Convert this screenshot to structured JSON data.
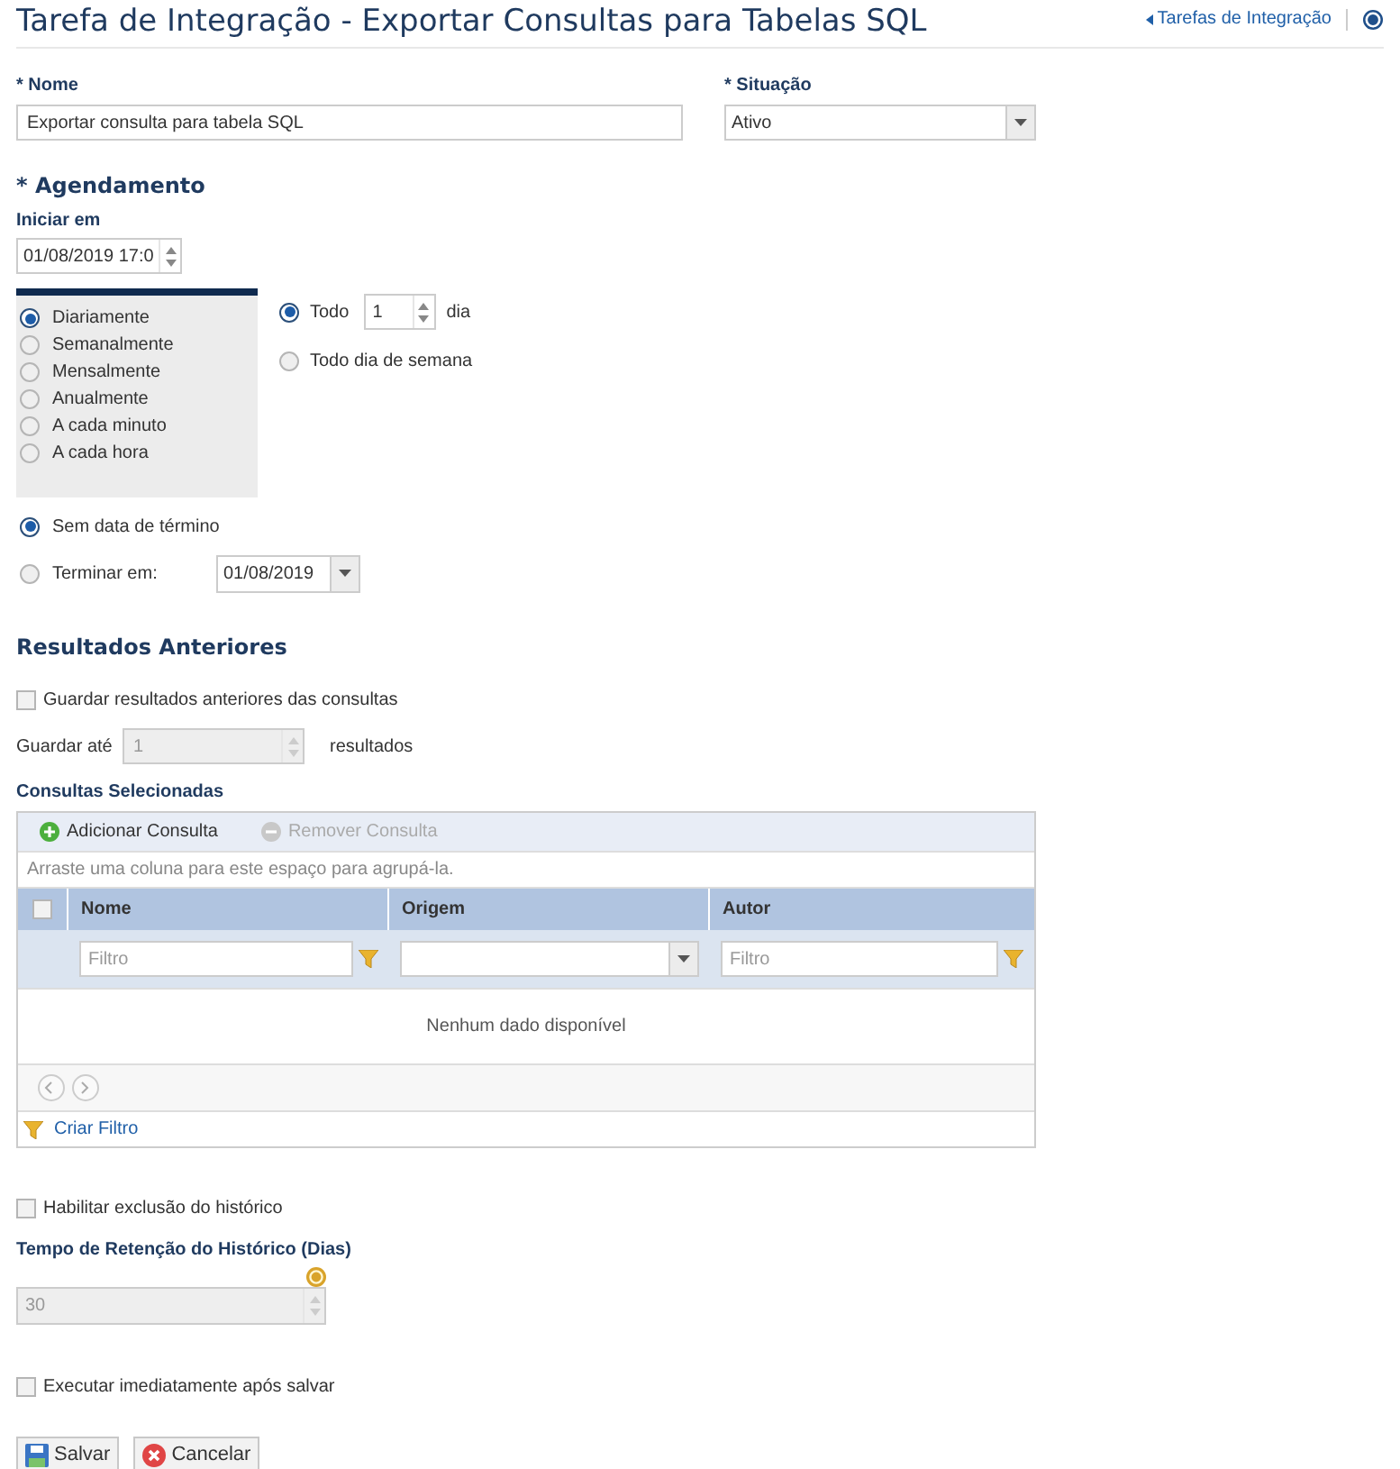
{
  "title": "Tarefa de Integração - Exportar Consultas para Tabelas SQL",
  "header_link": "Tarefas de Integração",
  "name_field": {
    "label": "* Nome",
    "value": "Exportar consulta para tabela SQL"
  },
  "status_field": {
    "label": "* Situação",
    "value": "Ativo"
  },
  "schedule": {
    "heading": "* Agendamento",
    "start_label": "Iniciar em",
    "start_value": "01/08/2019 17:0",
    "frequencies": [
      {
        "label": "Diariamente",
        "selected": true
      },
      {
        "label": "Semanalmente",
        "selected": false
      },
      {
        "label": "Mensalmente",
        "selected": false
      },
      {
        "label": "Anualmente",
        "selected": false
      },
      {
        "label": "A cada minuto",
        "selected": false
      },
      {
        "label": "A cada hora",
        "selected": false
      }
    ],
    "daily_options": [
      {
        "kind": "interval",
        "label": "Todo",
        "value": "1",
        "unit": "dia",
        "selected": true
      },
      {
        "kind": "plain",
        "label": "Todo dia de semana",
        "selected": false
      }
    ],
    "end_options": [
      {
        "kind": "plain",
        "label": "Sem data de término",
        "selected": true
      },
      {
        "kind": "date",
        "label": "Terminar em:",
        "value": "01/08/2019",
        "selected": false
      }
    ]
  },
  "previous_results": {
    "heading": "Resultados Anteriores",
    "checkbox": {
      "label": "Guardar resultados anteriores das consultas",
      "checked": false
    },
    "keep_label": "Guardar até",
    "keep_value": "1",
    "keep_unit": "resultados",
    "disabled": true
  },
  "selected_queries": {
    "heading": "Consultas Selecionadas",
    "add_button": "Adicionar Consulta",
    "remove_button": "Remover Consulta",
    "group_hint": "Arraste uma coluna para este espaço para agrupá-la.",
    "select_all_checked": false,
    "columns": [
      {
        "label": "Nome",
        "kind": "text",
        "placeholder": "Filtro"
      },
      {
        "label": "Origem",
        "kind": "select"
      },
      {
        "label": "Autor",
        "kind": "text",
        "placeholder": "Filtro"
      }
    ],
    "empty_message": "Nenhum dado disponível",
    "create_filter": "Criar Filtro"
  },
  "history": {
    "checkbox": {
      "label": "Habilitar exclusão do histórico",
      "checked": false
    },
    "retention_label": "Tempo de Retenção do Histórico (Dias)",
    "retention_value": "30",
    "disabled": true
  },
  "run_now": {
    "label": "Executar imediatamente após salvar",
    "checked": false
  },
  "buttons": [
    {
      "kind": "save",
      "label": "Salvar"
    },
    {
      "kind": "cancel",
      "label": "Cancelar"
    }
  ]
}
